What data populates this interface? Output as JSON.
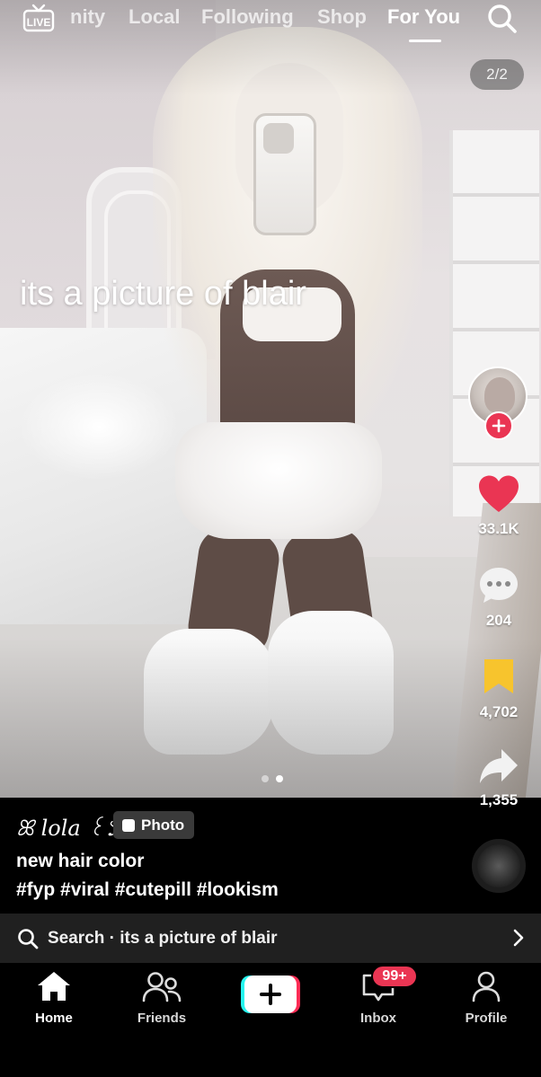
{
  "top_nav": {
    "live_label": "LIVE",
    "tabs": [
      {
        "label": "nity",
        "active": false
      },
      {
        "label": "Local",
        "active": false
      },
      {
        "label": "Following",
        "active": false
      },
      {
        "label": "Shop",
        "active": false
      },
      {
        "label": "For You",
        "active": true
      }
    ],
    "search_icon": "search-icon"
  },
  "media": {
    "counter": "2/2",
    "overlay_text": "its a picture of blair",
    "carousel": {
      "total": 2,
      "current": 2
    }
  },
  "right_rail": {
    "follow_icon": "plus-icon",
    "likes": "33.1K",
    "comments": "204",
    "saves": "4,702",
    "shares": "1,355",
    "colors": {
      "like": "#ea3553",
      "save": "#f7c42d",
      "follow": "#ea3553"
    }
  },
  "post": {
    "author": "ꕤ lola ꒰১",
    "badge_label": "Photo",
    "caption": "new hair color",
    "hashtags": "#fyp #viral #cutepill #lookism"
  },
  "search_suggestion": {
    "text": "Search · its a picture of blair"
  },
  "bottom_nav": {
    "items": [
      {
        "label": "Home",
        "icon": "home-icon",
        "active": true
      },
      {
        "label": "Friends",
        "icon": "friends-icon",
        "active": false
      },
      {
        "label": "",
        "icon": "create-icon",
        "active": false
      },
      {
        "label": "Inbox",
        "icon": "inbox-icon",
        "active": false
      },
      {
        "label": "Profile",
        "icon": "profile-icon",
        "active": false
      }
    ],
    "inbox_badge": "99+"
  }
}
